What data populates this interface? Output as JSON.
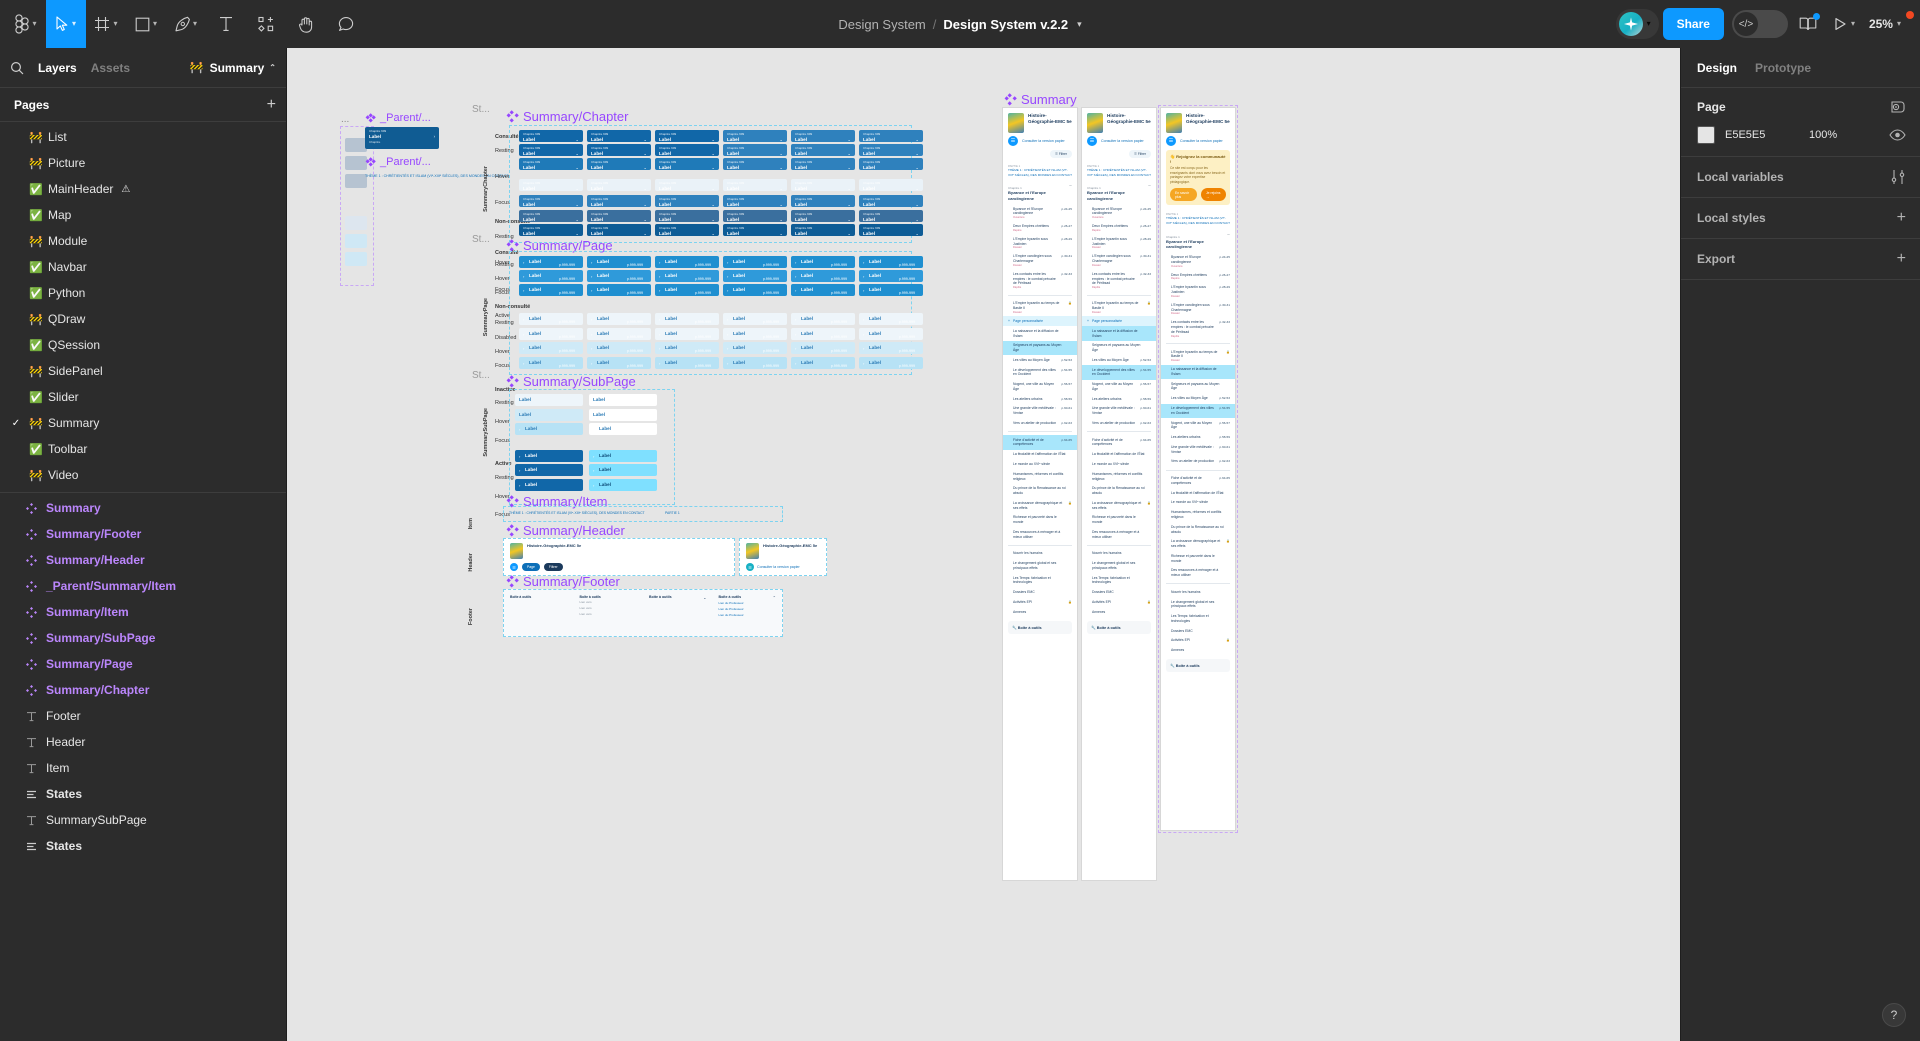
{
  "toolbar": {
    "menu_icon": "figma-menu-icon",
    "tools": [
      {
        "name": "move-tool",
        "icon": "cursor-arrow-icon",
        "active": true,
        "has_caret": true
      },
      {
        "name": "frame-tool",
        "icon": "frame-icon",
        "active": false,
        "has_caret": true
      },
      {
        "name": "shape-tool",
        "icon": "square-icon",
        "active": false,
        "has_caret": true
      },
      {
        "name": "pen-tool",
        "icon": "pen-icon",
        "active": false,
        "has_caret": true
      },
      {
        "name": "text-tool",
        "icon": "text-t-icon",
        "active": false,
        "has_caret": false
      },
      {
        "name": "resources-tool",
        "icon": "components-plus-icon",
        "active": false,
        "has_caret": false
      },
      {
        "name": "hand-tool",
        "icon": "hand-icon",
        "active": false,
        "has_caret": false
      },
      {
        "name": "comment-tool",
        "icon": "comment-bubble-icon",
        "active": false,
        "has_caret": false
      }
    ],
    "breadcrumb_project": "Design System",
    "breadcrumb_separator": "/",
    "file_name": "Design System v.2.2",
    "file_caret": "▾",
    "avatar_caret": "▾",
    "share_label": "Share",
    "dev_mode_icon": "code-brackets-icon",
    "library_icon": "book-icon",
    "present_icon": "play-triangle-icon",
    "zoom_level": "25%",
    "zoom_caret": "▾"
  },
  "left_panel": {
    "search_icon": "search-icon",
    "tabs": [
      {
        "label": "Layers",
        "selected": true
      },
      {
        "label": "Assets",
        "selected": false
      }
    ],
    "current_page_chip": {
      "emoji": "🚧",
      "label": "Summary",
      "caret": "⌃"
    },
    "pages_title": "Pages",
    "add_page_icon": "plus-icon",
    "pages": [
      {
        "emoji": "🚧",
        "label": "List",
        "selected": false,
        "suffix": ""
      },
      {
        "emoji": "🚧",
        "label": "Picture",
        "selected": false,
        "suffix": ""
      },
      {
        "emoji": "✅",
        "label": "MainHeader",
        "selected": false,
        "suffix": "⚠"
      },
      {
        "emoji": "✅",
        "label": "Map",
        "selected": false,
        "suffix": ""
      },
      {
        "emoji": "🚧",
        "label": "Module",
        "selected": false,
        "suffix": ""
      },
      {
        "emoji": "✅",
        "label": "Navbar",
        "selected": false,
        "suffix": ""
      },
      {
        "emoji": "✅",
        "label": "Python",
        "selected": false,
        "suffix": ""
      },
      {
        "emoji": "🚧",
        "label": "QDraw",
        "selected": false,
        "suffix": ""
      },
      {
        "emoji": "✅",
        "label": "QSession",
        "selected": false,
        "suffix": ""
      },
      {
        "emoji": "🚧",
        "label": "SidePanel",
        "selected": false,
        "suffix": ""
      },
      {
        "emoji": "✅",
        "label": "Slider",
        "selected": false,
        "suffix": ""
      },
      {
        "emoji": "🚧",
        "label": "Summary",
        "selected": true,
        "suffix": ""
      },
      {
        "emoji": "✅",
        "label": "Toolbar",
        "selected": false,
        "suffix": ""
      },
      {
        "emoji": "🚧",
        "label": "Video",
        "selected": false,
        "suffix": ""
      }
    ],
    "layers": [
      {
        "type": "component",
        "label": "Summary"
      },
      {
        "type": "component",
        "label": "Summary/Footer"
      },
      {
        "type": "component",
        "label": "Summary/Header"
      },
      {
        "type": "component",
        "label": "_Parent/Summary/Item"
      },
      {
        "type": "component",
        "label": "Summary/Item"
      },
      {
        "type": "component",
        "label": "Summary/SubPage"
      },
      {
        "type": "component",
        "label": "Summary/Page"
      },
      {
        "type": "component",
        "label": "Summary/Chapter"
      },
      {
        "type": "text",
        "label": "Footer"
      },
      {
        "type": "text",
        "label": "Header"
      },
      {
        "type": "text",
        "label": "Item"
      },
      {
        "type": "group",
        "label": "States"
      },
      {
        "type": "text",
        "label": "SummarySubPage"
      },
      {
        "type": "group",
        "label": "States"
      }
    ]
  },
  "right_panel": {
    "tabs": [
      {
        "label": "Design",
        "selected": true
      },
      {
        "label": "Prototype",
        "selected": false
      }
    ],
    "page_section": {
      "title": "Page",
      "settings_icon": "page-settings-icon",
      "color_hex": "E5E5E5",
      "color_value": "#E5E5E5",
      "opacity": "100%",
      "visibility_icon": "eye-icon"
    },
    "local_variables": {
      "title": "Local variables",
      "icon": "variables-sliders-icon"
    },
    "local_styles": {
      "title": "Local styles",
      "icon": "plus-icon"
    },
    "export": {
      "title": "Export",
      "icon": "plus-icon"
    },
    "help_icon": "question-mark-icon"
  },
  "canvas": {
    "state_header": "St...",
    "parent_labels": [
      "_Parent/...",
      "_Parent/..."
    ],
    "ellipsis_label": "...",
    "components": [
      {
        "name": "Summary/Chapter",
        "vertical_label": "SummaryChapter"
      },
      {
        "name": "Summary/Page",
        "vertical_label": "SummaryPage"
      },
      {
        "name": "Summary/SubPage",
        "vertical_label": "SummarySubPage"
      },
      {
        "name": "Summary/Item",
        "vertical_label": "Item"
      },
      {
        "name": "Summary/Header",
        "vertical_label": "Header"
      },
      {
        "name": "Summary/Footer",
        "vertical_label": "Footer"
      },
      {
        "name": "Summary",
        "vertical_label": ""
      }
    ],
    "state_groups": {
      "consulted": "Consulté",
      "not_consulted": "Non-consulté",
      "inactive": "Inactive",
      "active": "Active"
    },
    "states": [
      "Resting",
      "Hover",
      "Focus",
      "Active",
      "Disabled"
    ],
    "chip_label": "Label",
    "chip_caption": "Chapitre",
    "chip_top": "Chapitre 999",
    "chip_page": "p.999-999",
    "mock": {
      "title": "Histoire-Géographie-EMC 5e",
      "paper_link": "Consulter la version papier",
      "banner_title": "👋 Rejoignez la communauté !",
      "banner_body": "Ce site est conçu pour les enseignants dont vous avez besoin et partagez votre expertise pédagogique.",
      "banner_btn1": "En savoir plus",
      "banner_btn2": "Je rejoins  →",
      "tag": "PARTIE 1",
      "part_link": "THÈME 1 : CHRÉTIENTÉS ET ISLAM (VIᵉ-XIIIᵉ SIÈCLES), DES MONDES EN CONTACT",
      "chapter_kicker": "Chapitre 1",
      "chapter_title": "Byzance et l'Europe carolingienne",
      "filter_label": "Filtrer",
      "perso_label": "Page personnalisée",
      "footer_title": "Boîte à outils",
      "items": [
        {
          "label": "Byzance et l'Europe carolingienne",
          "sub": "Ouverture",
          "page": "p.24-25"
        },
        {
          "label": "Deux Empires chrétiens",
          "sub": "Repère",
          "page": "p.26-27"
        },
        {
          "label": "L'Empire byzantin sous Justinien",
          "sub": "Dossier",
          "page": "p.28-29"
        },
        {
          "label": "L'Empire carolingien sous Charlemagne",
          "sub": "Dossier",
          "page": "p.30-31"
        },
        {
          "label": "Les contacts entre les empires : le combat précaire de Péribsad",
          "sub": "Dépôts",
          "page": "p.32-33"
        },
        {
          "label": "L'Empire byzantin au temps de Basile II",
          "sub": "Dossier",
          "page": ""
        },
        {
          "label": "La naissance et la diffusion de l'Islam",
          "sub": "",
          "page": ""
        },
        {
          "label": "Seigneurs et paysans au Moyen Âge",
          "sub": "",
          "page": ""
        },
        {
          "label": "Les villes au Moyen Âge",
          "sub": "",
          "page": "p.52-53"
        },
        {
          "label": "Le développement des villes en Occident",
          "sub": "",
          "page": "p.54-55"
        },
        {
          "label": "Nogent, une ville au Moyen Âge",
          "sub": "",
          "page": "p.56-57"
        },
        {
          "label": "Les ateliers urbains",
          "sub": "",
          "page": "p.58-59"
        },
        {
          "label": "Une grande ville médiévale : Venise",
          "sub": "",
          "page": "p.60-61"
        },
        {
          "label": "Vers un atelier de production",
          "sub": "",
          "page": "p.62-63"
        },
        {
          "label": "Fiche d'activité et de compétences",
          "sub": "",
          "page": "p.64-65"
        },
        {
          "label": "La féodalité et l'affirmation de l'État",
          "sub": "",
          "page": ""
        },
        {
          "label": "Le monde au XVIᵉ siècle",
          "sub": "",
          "page": ""
        },
        {
          "label": "Humanismes, réformes et conflits religieux",
          "sub": "",
          "page": ""
        },
        {
          "label": "Du prince de la Renaissance au roi absolu",
          "sub": "",
          "page": ""
        },
        {
          "label": "La croissance démographique et ses effets",
          "sub": "",
          "page": ""
        },
        {
          "label": "Richesse et pauvreté dans le monde",
          "sub": "",
          "page": ""
        },
        {
          "label": "Des ressources à ménager et à mieux utiliser",
          "sub": "",
          "page": ""
        },
        {
          "label": "Nourrir les humains",
          "sub": "",
          "page": ""
        },
        {
          "label": "Le changement global et ses principaux effets",
          "sub": "",
          "page": ""
        },
        {
          "label": "Les Temps: fabrication et technologies",
          "sub": "",
          "page": ""
        },
        {
          "label": "Dossiers EMC",
          "sub": "",
          "page": ""
        },
        {
          "label": "Activités EPI",
          "sub": "",
          "page": ""
        },
        {
          "label": "Annexes",
          "sub": "",
          "page": ""
        }
      ]
    }
  }
}
